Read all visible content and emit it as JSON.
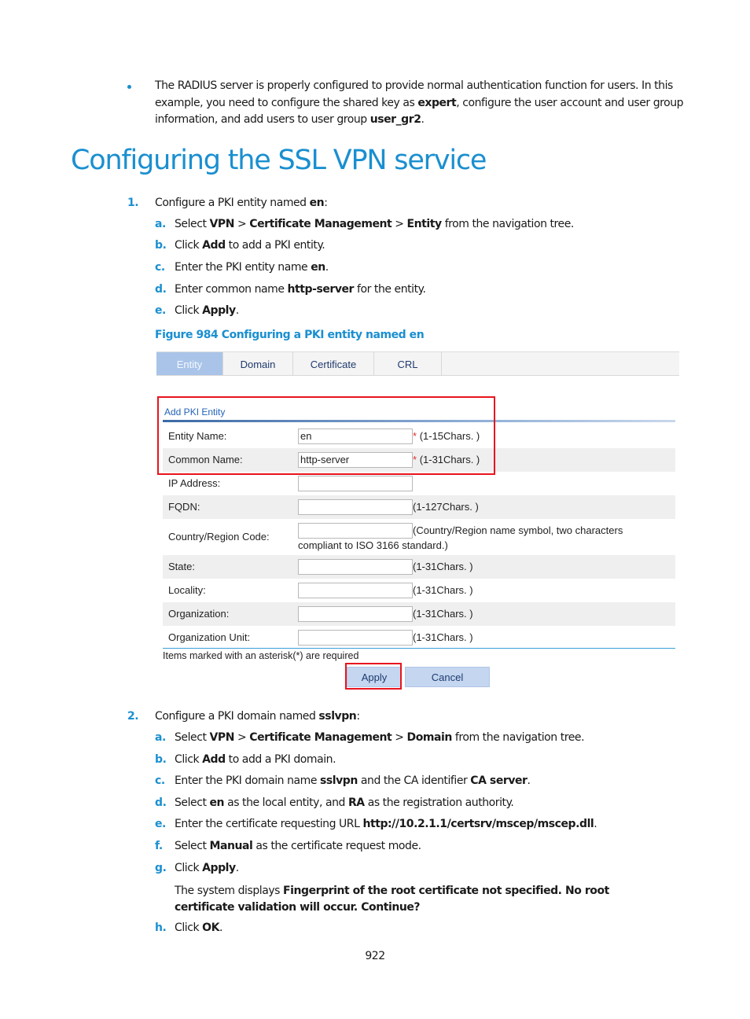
{
  "intro_bullet": {
    "segments": [
      {
        "t": "The RADIUS server is properly configured to provide normal authentication function for users. In this example, you need to configure the shared key as ",
        "b": false
      },
      {
        "t": "expert",
        "b": true
      },
      {
        "t": ", configure the user account and user group information, and add users to user group ",
        "b": false
      },
      {
        "t": "user_gr2",
        "b": true
      },
      {
        "t": ".",
        "b": false
      }
    ]
  },
  "section_title": "Configuring the SSL VPN service",
  "steps": [
    {
      "num": "1.",
      "segments": [
        {
          "t": "Configure a PKI entity named ",
          "b": false
        },
        {
          "t": "en",
          "b": true
        },
        {
          "t": ":",
          "b": false
        }
      ],
      "substeps": [
        {
          "letter": "a.",
          "segments": [
            {
              "t": "Select ",
              "b": false
            },
            {
              "t": "VPN",
              "b": true
            },
            {
              "t": " > ",
              "b": false
            },
            {
              "t": "Certificate Management",
              "b": true
            },
            {
              "t": " > ",
              "b": false
            },
            {
              "t": "Entity",
              "b": true
            },
            {
              "t": " from the navigation tree.",
              "b": false
            }
          ]
        },
        {
          "letter": "b.",
          "segments": [
            {
              "t": "Click ",
              "b": false
            },
            {
              "t": "Add",
              "b": true
            },
            {
              "t": " to add a PKI entity.",
              "b": false
            }
          ]
        },
        {
          "letter": "c.",
          "segments": [
            {
              "t": "Enter the PKI entity name ",
              "b": false
            },
            {
              "t": "en",
              "b": true
            },
            {
              "t": ".",
              "b": false
            }
          ]
        },
        {
          "letter": "d.",
          "segments": [
            {
              "t": "Enter common name ",
              "b": false
            },
            {
              "t": "http-server",
              "b": true
            },
            {
              "t": " for the entity.",
              "b": false
            }
          ]
        },
        {
          "letter": "e.",
          "segments": [
            {
              "t": "Click ",
              "b": false
            },
            {
              "t": "Apply",
              "b": true
            },
            {
              "t": ".",
              "b": false
            }
          ]
        }
      ]
    },
    {
      "num": "2.",
      "segments": [
        {
          "t": "Configure a PKI domain named ",
          "b": false
        },
        {
          "t": "sslvpn",
          "b": true
        },
        {
          "t": ":",
          "b": false
        }
      ],
      "substeps": [
        {
          "letter": "a.",
          "segments": [
            {
              "t": "Select ",
              "b": false
            },
            {
              "t": "VPN",
              "b": true
            },
            {
              "t": " > ",
              "b": false
            },
            {
              "t": "Certificate Management",
              "b": true
            },
            {
              "t": " > ",
              "b": false
            },
            {
              "t": "Domain",
              "b": true
            },
            {
              "t": " from the navigation tree.",
              "b": false
            }
          ]
        },
        {
          "letter": "b.",
          "segments": [
            {
              "t": "Click ",
              "b": false
            },
            {
              "t": "Add",
              "b": true
            },
            {
              "t": " to add a PKI domain.",
              "b": false
            }
          ]
        },
        {
          "letter": "c.",
          "segments": [
            {
              "t": "Enter the PKI domain name ",
              "b": false
            },
            {
              "t": "sslvpn",
              "b": true
            },
            {
              "t": " and the CA identifier ",
              "b": false
            },
            {
              "t": "CA server",
              "b": true
            },
            {
              "t": ".",
              "b": false
            }
          ]
        },
        {
          "letter": "d.",
          "segments": [
            {
              "t": "Select ",
              "b": false
            },
            {
              "t": "en",
              "b": true
            },
            {
              "t": " as the local entity, and ",
              "b": false
            },
            {
              "t": "RA",
              "b": true
            },
            {
              "t": " as the registration authority.",
              "b": false
            }
          ]
        },
        {
          "letter": "e.",
          "segments": [
            {
              "t": "Enter the certificate requesting URL ",
              "b": false
            },
            {
              "t": "http://10.2.1.1/certsrv/mscep/mscep.dll",
              "b": true
            },
            {
              "t": ".",
              "b": false
            }
          ]
        },
        {
          "letter": "f.",
          "segments": [
            {
              "t": "Select ",
              "b": false
            },
            {
              "t": "Manual",
              "b": true
            },
            {
              "t": " as the certificate request mode.",
              "b": false
            }
          ]
        },
        {
          "letter": "g.",
          "segments": [
            {
              "t": "Click ",
              "b": false
            },
            {
              "t": "Apply",
              "b": true
            },
            {
              "t": ".",
              "b": false
            }
          ]
        },
        {
          "letter": "h.",
          "segments": [
            {
              "t": "Click ",
              "b": false
            },
            {
              "t": "OK",
              "b": true
            },
            {
              "t": ".",
              "b": false
            }
          ]
        }
      ],
      "note": {
        "segments": [
          {
            "t": "The system displays ",
            "b": false
          },
          {
            "t": "Fingerprint of the root certificate not specified. No root certificate validation will occur. Continue?",
            "b": true
          }
        ]
      }
    }
  ],
  "figure": {
    "caption": "Figure 984 Configuring a PKI entity named en",
    "tabs": [
      {
        "label": "Entity",
        "active": true
      },
      {
        "label": "Domain",
        "active": false
      },
      {
        "label": "Certificate",
        "active": false
      },
      {
        "label": "CRL",
        "active": false
      }
    ],
    "form_title": "Add PKI Entity",
    "fields": [
      {
        "label": "Entity Name:",
        "value": "en",
        "required": true,
        "hint": "(1-15Chars. )"
      },
      {
        "label": "Common Name:",
        "value": "http-server",
        "required": true,
        "hint": "(1-31Chars. )"
      },
      {
        "label": "IP Address:",
        "value": "",
        "required": false,
        "hint": ""
      },
      {
        "label": "FQDN:",
        "value": "",
        "required": false,
        "hint": "(1-127Chars. )"
      },
      {
        "label": "Country/Region Code:",
        "value": "",
        "required": false,
        "hint": "(Country/Region name symbol, two characters",
        "hint2": "compliant to ISO 3166 standard.)"
      },
      {
        "label": "State:",
        "value": "",
        "required": false,
        "hint": "(1-31Chars. )"
      },
      {
        "label": "Locality:",
        "value": "",
        "required": false,
        "hint": "(1-31Chars. )"
      },
      {
        "label": "Organization:",
        "value": "",
        "required": false,
        "hint": "(1-31Chars. )"
      },
      {
        "label": "Organization Unit:",
        "value": "",
        "required": false,
        "hint": "(1-31Chars. )"
      }
    ],
    "required_star": "*",
    "required_note": "Items marked with an asterisk(*) are required",
    "apply_label": "Apply",
    "cancel_label": "Cancel"
  },
  "page_number": "922"
}
